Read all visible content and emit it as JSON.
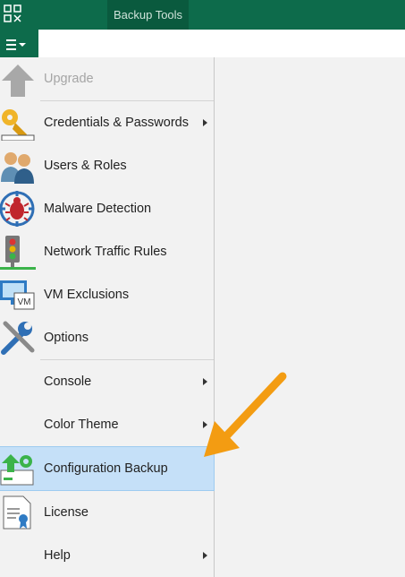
{
  "titlebar": {
    "tab_label": "Backup Tools"
  },
  "colors": {
    "brand": "#0d6b4b",
    "selected": "#c5e0f8",
    "arrow": "#f39c12"
  },
  "menu": {
    "items": [
      {
        "label": "Upgrade",
        "icon": "upgrade-arrow-icon",
        "disabled": true
      },
      {
        "label": "Credentials & Passwords",
        "icon": "key-icon",
        "submenu": true
      },
      {
        "label": "Users & Roles",
        "icon": "users-icon"
      },
      {
        "label": "Malware Detection",
        "icon": "malware-bug-icon"
      },
      {
        "label": "Network Traffic Rules",
        "icon": "traffic-light-icon"
      },
      {
        "label": "VM Exclusions",
        "icon": "vm-monitor-icon"
      },
      {
        "label": "Options",
        "icon": "tools-icon"
      },
      {
        "label": "Console",
        "submenu": true
      },
      {
        "label": "Color Theme",
        "submenu": true
      },
      {
        "label": "Configuration Backup",
        "icon": "config-backup-icon",
        "selected": true
      },
      {
        "label": "License",
        "icon": "license-certificate-icon"
      },
      {
        "label": "Help",
        "submenu": true
      }
    ]
  }
}
